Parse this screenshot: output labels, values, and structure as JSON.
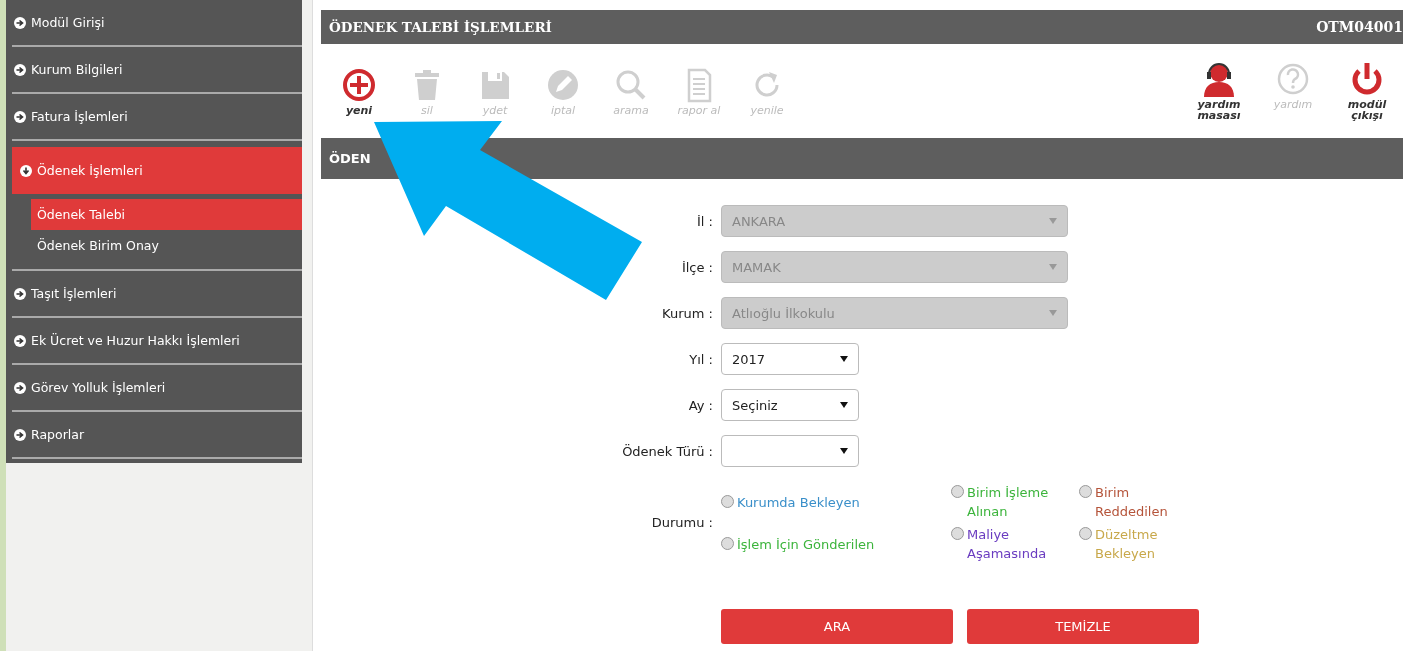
{
  "sidebar": {
    "items": [
      {
        "label": "Modül Girişi",
        "expanded": false
      },
      {
        "label": "Kurum Bilgileri",
        "expanded": false
      },
      {
        "label": "Fatura İşlemleri",
        "expanded": false
      },
      {
        "label": "Ödenek İşlemleri",
        "expanded": true,
        "children": [
          {
            "label": "Ödenek Talebi",
            "selected": true
          },
          {
            "label": "Ödenek Birim Onay",
            "selected": false
          }
        ]
      },
      {
        "label": "Taşıt İşlemleri",
        "expanded": false
      },
      {
        "label": "Ek Ücret ve Huzur Hakkı İşlemleri",
        "expanded": false
      },
      {
        "label": "Görev Yolluk İşlemleri",
        "expanded": false
      },
      {
        "label": "Raporlar",
        "expanded": false
      }
    ]
  },
  "panel": {
    "title": "ÖDENEK TALEBİ İŞLEMLERİ",
    "code": "OTM04001"
  },
  "toolbar": {
    "left": [
      {
        "label": "yeni",
        "disabled": false
      },
      {
        "label": "sil",
        "disabled": true
      },
      {
        "label": "ydet",
        "disabled": true
      },
      {
        "label": "iptal",
        "disabled": true
      },
      {
        "label": "arama",
        "disabled": true
      },
      {
        "label": "rapor al",
        "disabled": true
      },
      {
        "label": "yenile",
        "disabled": true
      }
    ],
    "right": [
      {
        "label": "yardım masası",
        "disabled": false
      },
      {
        "label": "yardım",
        "disabled": true
      },
      {
        "label": "modül çıkışı",
        "disabled": false
      }
    ]
  },
  "section": {
    "title": "ÖDEN"
  },
  "form": {
    "fields": [
      {
        "label": "İl :",
        "value": "ANKARA",
        "disabled": true
      },
      {
        "label": "İlçe :",
        "value": "MAMAK",
        "disabled": true
      },
      {
        "label": "Kurum :",
        "value": "Atlıoğlu İlkokulu",
        "disabled": true
      },
      {
        "label": "Yıl :",
        "value": "2017",
        "disabled": false
      },
      {
        "label": "Ay :",
        "value": "Seçiniz",
        "disabled": false
      },
      {
        "label": "Ödenek Türü :",
        "disabled": false
      }
    ],
    "status": {
      "label": "Durumu :",
      "options": [
        {
          "label": "Kurumda Bekleyen",
          "color": "#3a8fc9",
          "checked": false
        },
        {
          "label": "İşlem İçin Gönderilen",
          "color": "#3cb43c",
          "checked": false
        },
        {
          "label": "Birim İşleme Alınan",
          "color": "#3cb43c",
          "checked": false
        },
        {
          "label": "Maliye Aşamasında",
          "color": "#6a3cc0",
          "checked": false
        },
        {
          "label": "Birim Reddedilen",
          "color": "#b5543a",
          "checked": false
        },
        {
          "label": "Düzeltme Bekleyen",
          "color": "#c8a84a",
          "checked": false
        }
      ]
    }
  },
  "buttons": [
    {
      "label": "ARA"
    },
    {
      "label": "TEMİZLE"
    }
  ]
}
